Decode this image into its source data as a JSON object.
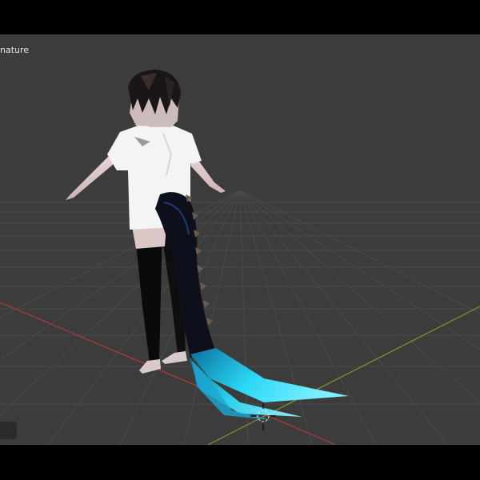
{
  "viewport": {
    "object_label": "nature",
    "background_color": "#3c3c3c",
    "grid_color": "#4a4a4a",
    "x_axis_color": "#b23a3a",
    "y_axis_color": "#7a9a2a"
  },
  "scene": {
    "model": "character-with-tail",
    "shirt_color": "#f4f4f4",
    "stockings_color": "#0a0a0a",
    "tail_color": "#0d0f1a",
    "tail_tip_color": "#2ad6f5"
  },
  "icons": {
    "cursor": "3d-cursor-icon",
    "widget": "viewport-widget-icon"
  }
}
